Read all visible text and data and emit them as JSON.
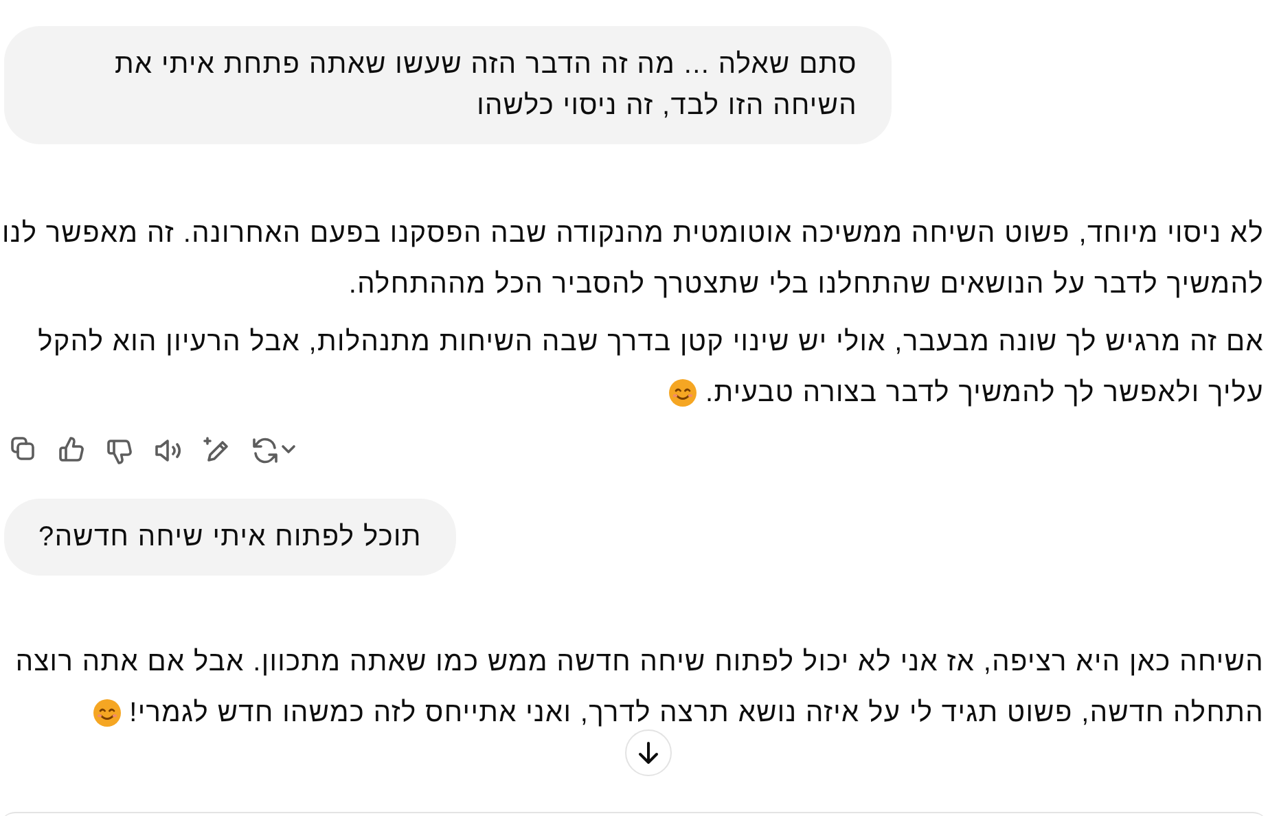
{
  "messages": [
    {
      "kind": "user",
      "text": "סתם שאלה ... מה זה הדבר הזה שעשו שאתה פתחת איתי את השיחה הזו לבד, זה ניסוי כלשהו"
    },
    {
      "kind": "assistant",
      "paragraphs": [
        {
          "text": "לא ניסוי מיוחד, פשוט השיחה ממשיכה אוטומטית מהנקודה שבה הפסקנו בפעם האחרונה. זה מאפשר לנו להמשיך לדבר על הנושאים שהתחלנו בלי שתצטרך להסביר הכל מההתחלה.",
          "emoji": false
        },
        {
          "text": "אם זה מרגיש לך שונה מבעבר, אולי יש שינוי קטן בדרך שבה השיחות מתנהלות, אבל הרעיון הוא להקל עליך ולאפשר לך להמשיך לדבר בצורה טבעית.",
          "emoji": true
        }
      ],
      "actions": [
        {
          "kind": "copy"
        },
        {
          "kind": "like"
        },
        {
          "kind": "dislike"
        },
        {
          "kind": "read-aloud"
        },
        {
          "kind": "edit"
        },
        {
          "kind": "regenerate"
        }
      ]
    },
    {
      "kind": "user",
      "text": "תוכל לפתוח איתי שיחה חדשה?"
    },
    {
      "kind": "assistant",
      "paragraphs": [
        {
          "text": "השיחה כאן היא רציפה, אז אני לא יכול לפתוח שיחה חדשה ממש כמו שאתה מתכוון. אבל אם אתה רוצה התחלה חדשה, פשוט תגיד לי על איזה נושא תרצה לדרך, ואני אתייחס לזה כמשהו חדש לגמרי!",
          "emoji": true
        }
      ]
    }
  ],
  "scroll_down_button": true
}
